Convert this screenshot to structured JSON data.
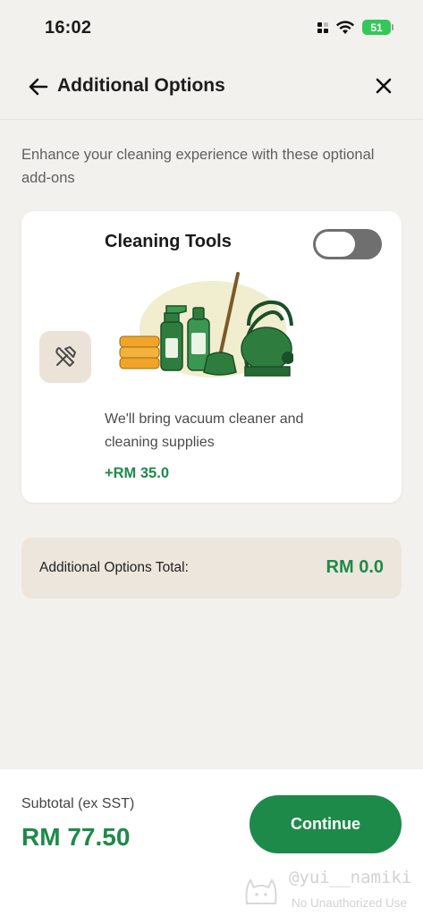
{
  "status_bar": {
    "time": "16:02",
    "battery": "51",
    "icons": [
      "signal-icon",
      "wifi-icon",
      "battery-charging-icon"
    ]
  },
  "header": {
    "title": "Additional Options",
    "back_icon": "arrow-left-icon",
    "close_icon": "close-icon"
  },
  "intro": "Enhance your cleaning experience with these optional add-ons",
  "option": {
    "title": "Cleaning Tools",
    "icon": "tools-icon",
    "enabled": false,
    "description": "We'll bring vacuum cleaner and cleaning supplies",
    "price": "+RM 35.0",
    "illustration": "cleaning-supplies-illustration"
  },
  "total": {
    "label": "Additional Options Total:",
    "value": "RM 0.0"
  },
  "footer": {
    "subtotal_label": "Subtotal (ex SST)",
    "subtotal_value": "RM 77.50",
    "continue_label": "Continue"
  },
  "watermark": {
    "line1": "@yui__namiki",
    "line2": "No Unauthorized Use"
  },
  "colors": {
    "accent": "#1e8a4a",
    "background": "#f3f1ee",
    "total_bg": "#ede6dc",
    "toggle_off": "#6f6f6f"
  }
}
